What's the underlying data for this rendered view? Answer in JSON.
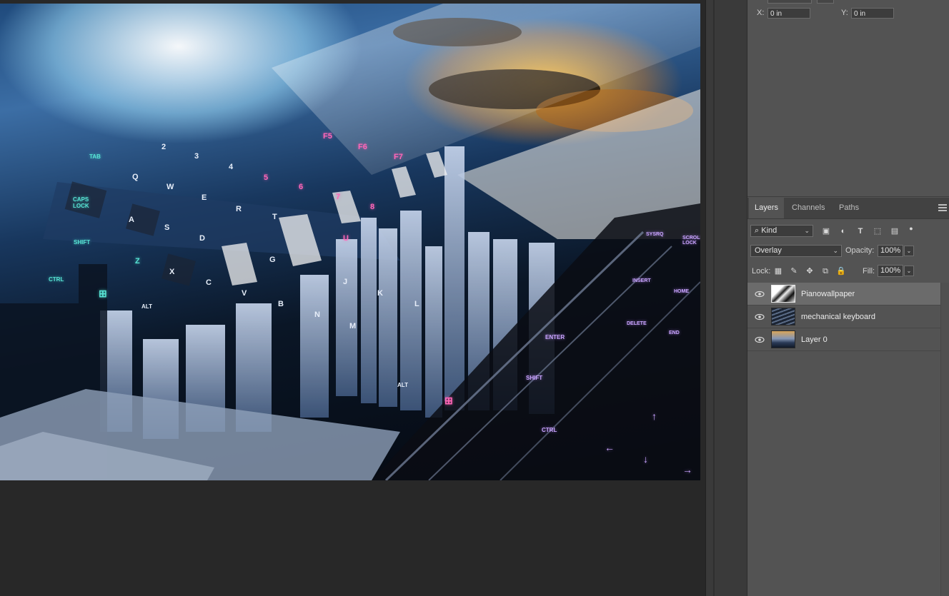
{
  "properties": {
    "x_label": "X:",
    "x_value": "0 in",
    "y_label": "Y:",
    "y_value": "0 in"
  },
  "layers_panel": {
    "tabs": [
      {
        "label": "Layers",
        "active": true
      },
      {
        "label": "Channels",
        "active": false
      },
      {
        "label": "Paths",
        "active": false
      }
    ],
    "filter_kind": "Kind",
    "blend_mode": "Overlay",
    "opacity_label": "Opacity:",
    "opacity_value": "100%",
    "lock_label": "Lock:",
    "fill_label": "Fill:",
    "fill_value": "100%",
    "layers": [
      {
        "name": "Pianowallpaper",
        "visible": true,
        "selected": true
      },
      {
        "name": "mechanical keyboard",
        "visible": true,
        "selected": false
      },
      {
        "name": "Layer 0",
        "visible": true,
        "selected": false
      }
    ]
  },
  "canvas": {
    "keycaps": {
      "f5": "F5",
      "f6": "F6",
      "f7": "F7",
      "tab": "TAB",
      "caps": "CAPS\nLOCK",
      "shift": "SHIFT",
      "ctrl": "CTRL",
      "alt": "ALT",
      "q": "Q",
      "w": "W",
      "e": "E",
      "r": "R",
      "t": "T",
      "u": "U",
      "g": "G",
      "a": "A",
      "s": "S",
      "d": "D",
      "z": "Z",
      "x": "X",
      "c": "C",
      "v": "V",
      "b": "B",
      "n": "N",
      "m": "M",
      "j": "J",
      "k": "K",
      "l": "L",
      "n2": "2",
      "n3": "3",
      "n4": "4",
      "n5": "5",
      "n6": "6",
      "n7": "7",
      "n8": "8",
      "insert": "INSERT",
      "home": "HOME",
      "delete": "DELETE",
      "end": "END",
      "enter": "ENTER",
      "shift_r": "SHIFT",
      "ctrl_r": "CTRL",
      "sysrq": "SYSRQ",
      "scroll_lock": "SCROLL\nLOCK",
      "arrow_up": "↑",
      "arrow_left": "←",
      "arrow_down": "↓",
      "arrow_right": "→"
    }
  }
}
